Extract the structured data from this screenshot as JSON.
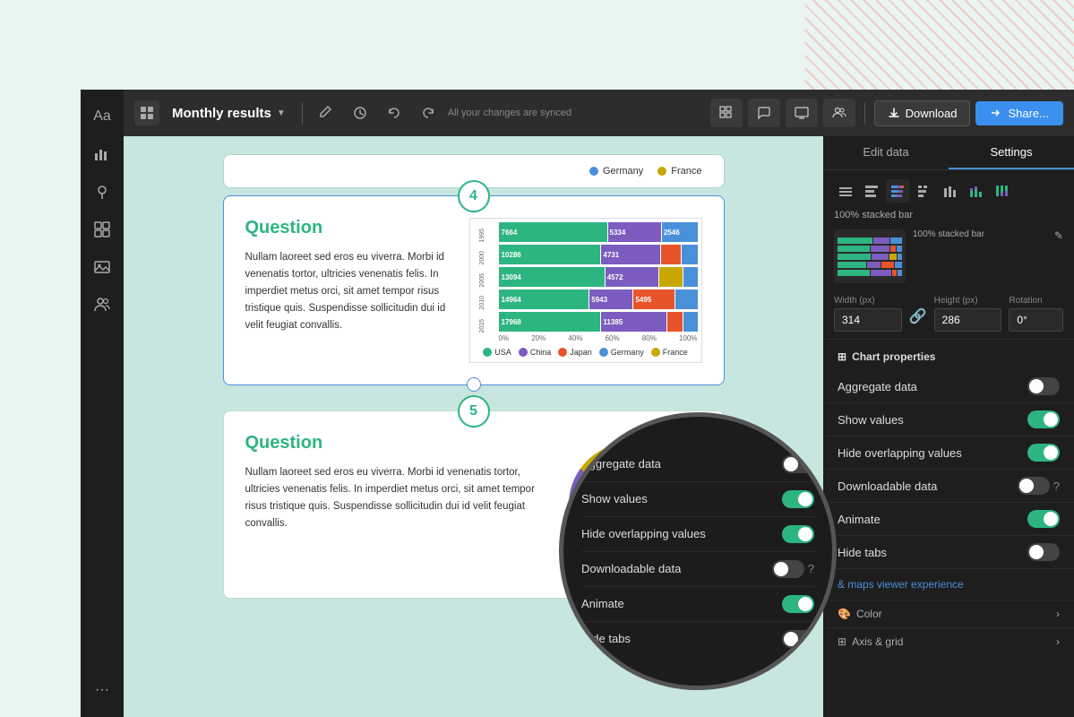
{
  "app": {
    "title": "Monthly results",
    "sync_status": "All your changes are synced",
    "download_label": "Download",
    "share_label": "Share..."
  },
  "toolbar": {
    "icons": [
      "🖊",
      "🕒",
      "↩",
      "↪"
    ]
  },
  "right_panel": {
    "tabs": [
      "Edit data",
      "Settings"
    ],
    "active_tab": "Settings",
    "chart_type_label": "100% stacked bar",
    "dimensions": {
      "width_label": "Width (px)",
      "width_value": "314",
      "height_label": "Height (px)",
      "height_value": "286",
      "rotation_label": "Rotation",
      "rotation_value": "0°"
    },
    "chart_properties_title": "Chart properties",
    "toggles": [
      {
        "label": "Aggregate data",
        "state": "off"
      },
      {
        "label": "Show values",
        "state": "on"
      },
      {
        "label": "Hide overlapping values",
        "state": "on"
      },
      {
        "label": "Downloadable data",
        "state": "off"
      },
      {
        "label": "Animate",
        "state": "on"
      },
      {
        "label": "Hide tabs",
        "state": "off"
      }
    ],
    "panel_link": "& maps viewer experience",
    "accordion_items": [
      {
        "label": "Color"
      },
      {
        "label": "Axis & grid"
      }
    ]
  },
  "cards": [
    {
      "number": "4",
      "title": "Question",
      "text": "Nullam laoreet sed eros eu viverra. Morbi id venenatis tortor, ultricies venenatis felis. In imperdiet metus orci, sit amet tempor risus tristique quis. Suspendisse sollicitudin dui id velit feugiat convallis.",
      "chart_type": "stacked_bar",
      "chart_data": {
        "rows": [
          {
            "year": "1995",
            "value": "7664",
            "segments": [
              {
                "pct": 55,
                "color": "green",
                "label": "7664"
              },
              {
                "pct": 27,
                "color": "purple",
                "label": "5334"
              },
              {
                "pct": 18,
                "color": "blue",
                "label": "2546"
              }
            ]
          },
          {
            "year": "2000",
            "value": "10286",
            "segments": [
              {
                "pct": 52,
                "color": "green",
                "label": "10286"
              },
              {
                "pct": 30,
                "color": "purple",
                "label": "4731"
              },
              {
                "pct": 12,
                "color": "orange",
                "label": ""
              },
              {
                "pct": 6,
                "color": "blue",
                "label": ""
              }
            ]
          },
          {
            "year": "2005",
            "value": "13094",
            "segments": [
              {
                "pct": 55,
                "color": "green",
                "label": "13094"
              },
              {
                "pct": 28,
                "color": "purple",
                "label": "4572"
              },
              {
                "pct": 10,
                "color": "yellow",
                "label": ""
              },
              {
                "pct": 7,
                "color": "blue",
                "label": ""
              }
            ]
          },
          {
            "year": "2010",
            "value": "14964",
            "segments": [
              {
                "pct": 50,
                "color": "green",
                "label": "14964"
              },
              {
                "pct": 22,
                "color": "purple",
                "label": "5943"
              },
              {
                "pct": 20,
                "color": "orange",
                "label": "5495"
              },
              {
                "pct": 8,
                "color": "blue",
                "label": ""
              }
            ]
          },
          {
            "year": "2015",
            "value": "17968",
            "segments": [
              {
                "pct": 52,
                "color": "green",
                "label": "17968"
              },
              {
                "pct": 33,
                "color": "purple",
                "label": "11385"
              },
              {
                "pct": 8,
                "color": "orange",
                "label": ""
              },
              {
                "pct": 7,
                "color": "blue",
                "label": ""
              }
            ]
          }
        ],
        "axis": [
          "0%",
          "20%",
          "40%",
          "60%",
          "80%",
          "100%"
        ],
        "legend": [
          {
            "label": "USA",
            "color": "#2db580"
          },
          {
            "label": "China",
            "color": "#7c5cbf"
          },
          {
            "label": "Japan",
            "color": "#e8542a"
          },
          {
            "label": "Germany",
            "color": "#4a90d9"
          },
          {
            "label": "France",
            "color": "#c8a800"
          }
        ]
      }
    },
    {
      "number": "5",
      "title": "Question",
      "text": "Nullam laoreet sed eros eu viverra. Morbi id venenatis tortor, ultricies venenatis felis. In imperdiet metus orci, sit amet tempor risus tristique quis. Suspendisse sollicitudin dui id velit feugiat convallis.",
      "chart_type": "donut"
    }
  ],
  "partial_card": {
    "legend_items": [
      "Germany",
      "France"
    ]
  }
}
